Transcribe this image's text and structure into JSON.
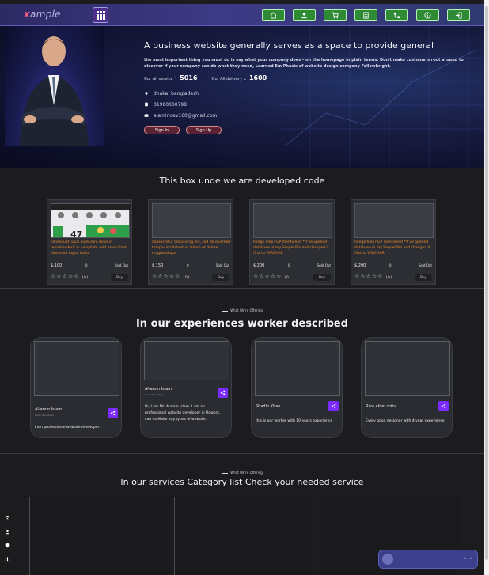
{
  "nav": {
    "logo_prefix": "x",
    "logo_rest": "ample",
    "icons": [
      "home-icon",
      "profile-icon",
      "cart-icon",
      "document-icon",
      "network-icon",
      "info-icon",
      "login-icon"
    ]
  },
  "hero": {
    "title": "A business website generally serves as a space to provide general",
    "description": "the most important thing you must do is say what your company does – on the homepage in plain terms. Don't make customers root around to discover if your company can do what they need, Learned Em Phasis of website design company Fallowbright.",
    "stats": [
      {
        "label": "Our All service",
        "value": "5016"
      },
      {
        "label": "Our All delivery",
        "value": "1600"
      }
    ],
    "contact": {
      "location": "dhaka, bangladesh",
      "phone": "01980000798",
      "email": "alamindev160@gmail.com"
    },
    "buttons": {
      "signin": "Sign In",
      "signup": "Sign Up"
    }
  },
  "products_section": {
    "title": "This box unde we are developed code",
    "items": [
      {
        "desc": "consequat. Duis aute irure dolor in reprehenderit in voluptate velit esse cillum dolore eu fugiat nulla",
        "price": "$.100",
        "count": "0",
        "sold": "Sold Out",
        "rating_count": "(0)",
        "buy": "Buy",
        "has_image": true
      },
      {
        "desc": "consectetur adipisicing elit, sed do eiusmod tempor incididunt ut labore et dolore magna aliqua",
        "price": "$.150",
        "count": "0",
        "sold": "Sold Out",
        "rating_count": "(0)",
        "buy": "Buy",
        "has_image": false
      },
      {
        "desc": "hange help? GP mentioned **I've opened database in my Sequel Pro and changed it first to VARCHAR",
        "price": "$.200",
        "count": "0",
        "sold": "Sold Out",
        "rating_count": "(0)",
        "buy": "Buy",
        "has_image": false
      },
      {
        "desc": "hange help? GP mentioned **I've opened database in my Sequel Pro and changed it first to VARCHAR",
        "price": "$.200",
        "count": "0",
        "sold": "Sold Out",
        "rating_count": "(0)",
        "buy": "Buy",
        "has_image": false
      }
    ]
  },
  "team_section": {
    "tag": "What We're Offering",
    "title": "In our experiences worker described",
    "members": [
      {
        "name": "Al-amin Islam",
        "role": "Team Developer",
        "bio": "I am professional website developer"
      },
      {
        "name": "Al-amin Islam",
        "role": "Team Developer",
        "bio": "Hi, I am Mr. Alamin Islam. I am an professional website developer in Upwork. I can do Make any types of website."
      },
      {
        "name": "Shadin Khan",
        "role": "",
        "bio": "this is our worker with 10 years experience"
      },
      {
        "name": "Riva akter mitu",
        "role": "",
        "bio": "Every good designer with 4 year experience"
      }
    ]
  },
  "category_section": {
    "tag": "What We're Offering",
    "title": "In our services Category list Check your needed service"
  },
  "chat_widget": {
    "dots": "•••"
  },
  "colors": {
    "accent": "#7a2cff",
    "nav_green": "#2f8a36",
    "price_orange": "#f08a2a"
  }
}
